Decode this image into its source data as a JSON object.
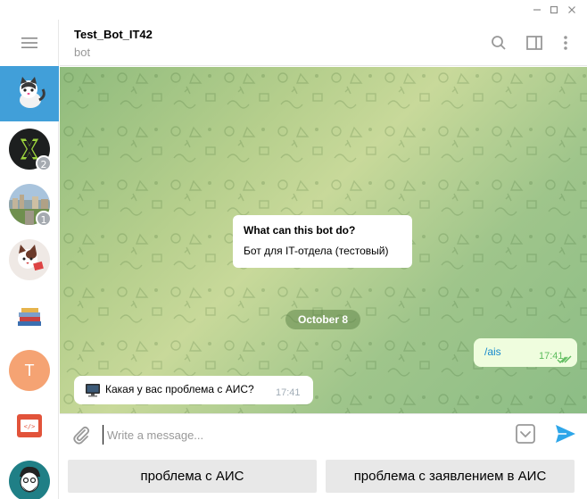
{
  "window": {
    "controls": [
      "minimize-icon",
      "maximize-icon",
      "close-icon"
    ]
  },
  "sidebar": {
    "menu_icon": "hamburger-menu-icon",
    "chats": [
      {
        "name": "chat-cat-bot",
        "active": true,
        "badge": ""
      },
      {
        "name": "chat-x-logo",
        "active": false,
        "badge": "2"
      },
      {
        "name": "chat-city",
        "active": false,
        "badge": "1"
      },
      {
        "name": "chat-cat-reading",
        "active": false,
        "badge": ""
      },
      {
        "name": "chat-books",
        "active": false,
        "badge": ""
      },
      {
        "name": "chat-t",
        "active": false,
        "badge": "",
        "letter": "T"
      },
      {
        "name": "chat-code",
        "active": false,
        "badge": ""
      },
      {
        "name": "chat-person",
        "active": false,
        "badge": ""
      }
    ]
  },
  "header": {
    "title": "Test_Bot_IT42",
    "subtitle": "bot",
    "icons": [
      "search-icon",
      "sidebar-toggle-icon",
      "more-vertical-icon"
    ]
  },
  "chat": {
    "info_card": {
      "title": "What can this bot do?",
      "text": "Бот для IT-отдела (тестовый)"
    },
    "date_separator": "October 8",
    "messages": [
      {
        "direction": "out",
        "text": "/ais",
        "time": "17:41",
        "status": "read"
      },
      {
        "direction": "in",
        "icon": "computer-icon",
        "text": "Какая у вас проблема с АИС?",
        "time": "17:41"
      }
    ]
  },
  "composer": {
    "placeholder": "Write a message...",
    "value": ""
  },
  "keyboard": {
    "buttons": [
      "проблема с АИС",
      "проблема с заявлением в АИС"
    ]
  },
  "colors": {
    "accent": "#419fd9",
    "outgoing_bubble": "#effdde",
    "badge": "#a5aab0",
    "send": "#2ea6e9"
  }
}
